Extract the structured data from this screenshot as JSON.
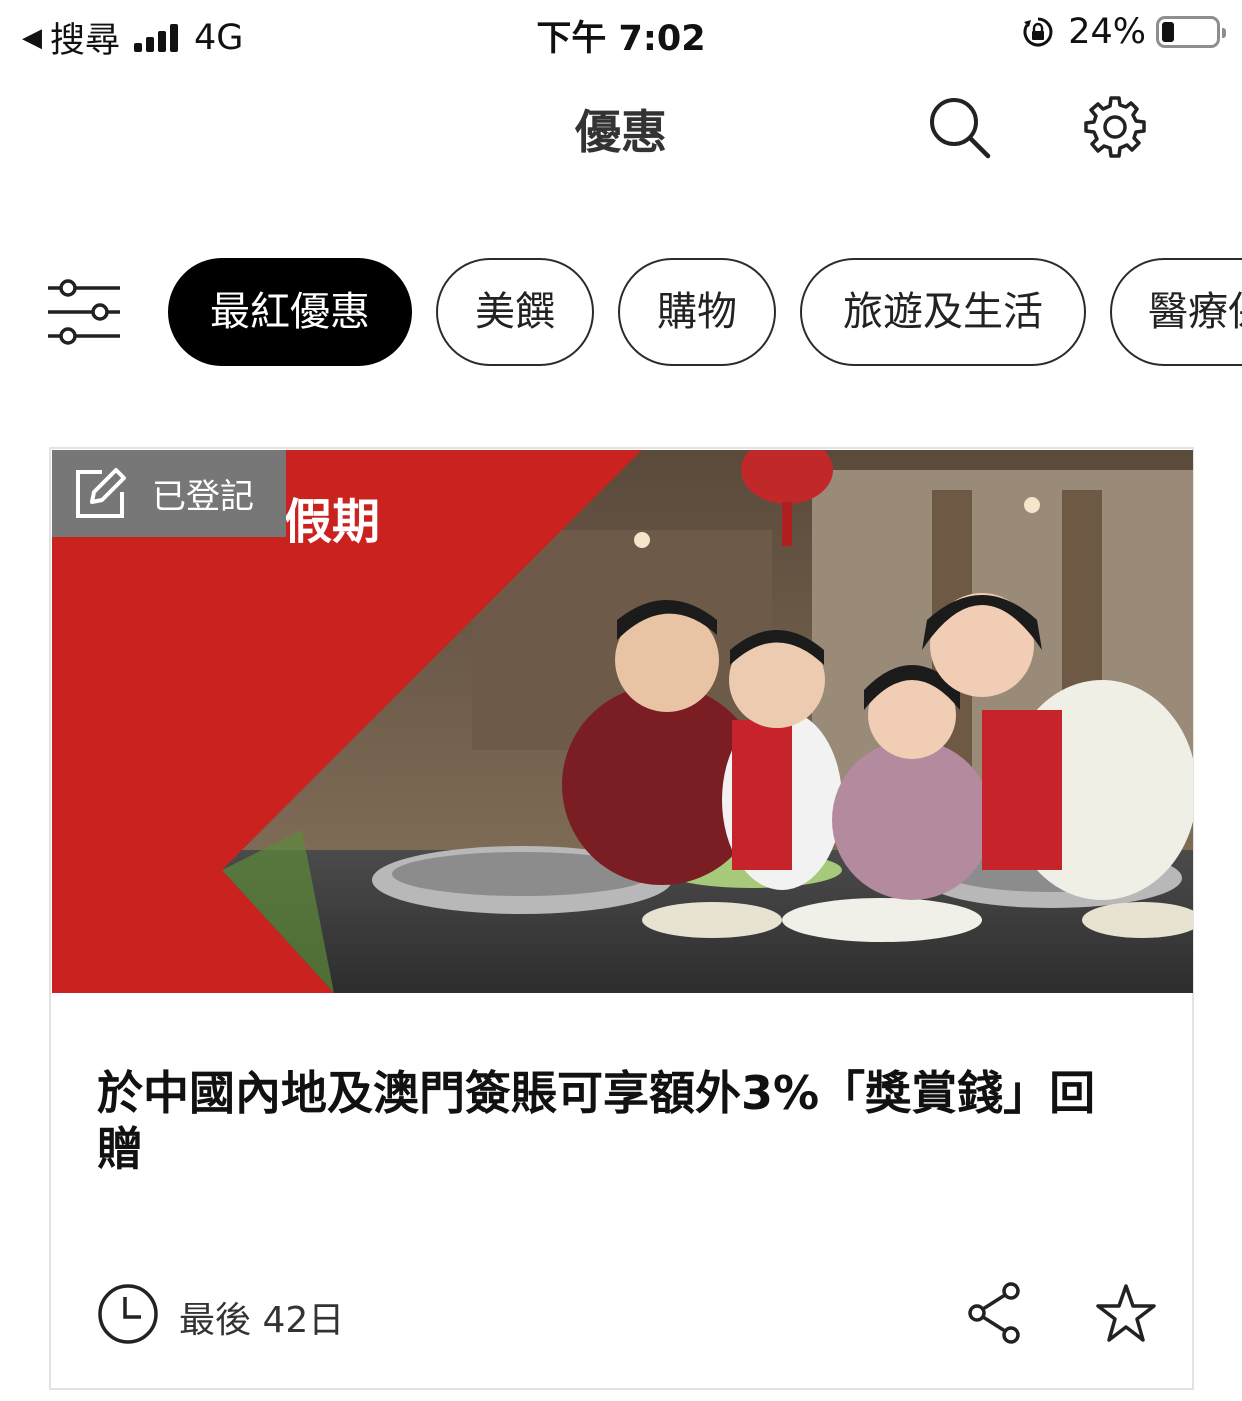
{
  "status_bar": {
    "back_label": "◀",
    "carrier": "搜尋",
    "network": "4G",
    "time": "下午 7:02",
    "battery_percent": "24%",
    "battery_level": 0.24
  },
  "header": {
    "title": "優惠"
  },
  "categories": {
    "items": [
      {
        "label": "最紅優惠",
        "active": true
      },
      {
        "label": "美饌",
        "active": false
      },
      {
        "label": "購物",
        "active": false
      },
      {
        "label": "旅遊及生活",
        "active": false
      },
      {
        "label": "醫療保",
        "active": false
      }
    ]
  },
  "offer": {
    "badge_label": "已登記",
    "banner_text": "假期",
    "title": "於中國內地及澳門簽賬可享額外3%「獎賞錢」回贈",
    "deadline": "最後 42日"
  },
  "colors": {
    "brand_red": "#c9221f",
    "chip_active_bg": "#000000",
    "badge_bg": "#777777"
  },
  "icons": [
    "search-icon",
    "gear-icon",
    "filter-sliders-icon",
    "edit-icon",
    "clock-icon",
    "share-icon",
    "star-icon",
    "lock-rotation-icon"
  ]
}
